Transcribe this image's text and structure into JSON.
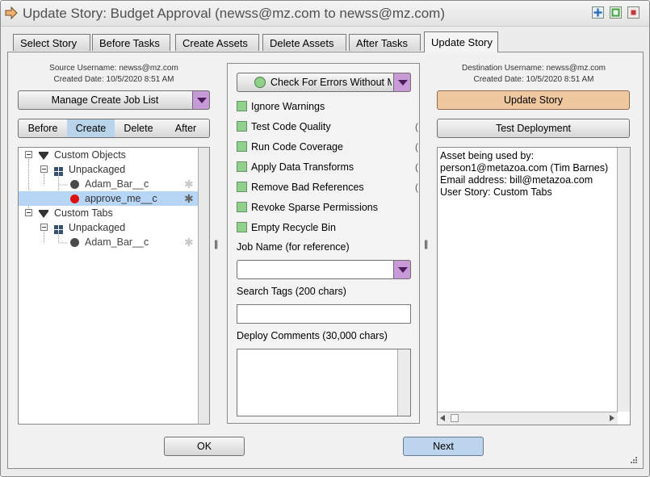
{
  "window": {
    "title": "Update Story: Budget Approval (newss@mz.com to newss@mz.com)",
    "buttons": [
      {
        "name": "maximize-button",
        "icon": "plus-icon",
        "color": "#2f6fc0"
      },
      {
        "name": "restore-button",
        "icon": "square-icon",
        "color": "#3fa33f"
      },
      {
        "name": "close-button",
        "icon": "stop-icon",
        "color": "#c23a3a"
      }
    ]
  },
  "tabs": [
    {
      "label": "Select Story"
    },
    {
      "label": "Before Tasks"
    },
    {
      "label": "Create Assets"
    },
    {
      "label": "Delete Assets"
    },
    {
      "label": "After Tasks"
    },
    {
      "label": "Update Story",
      "active": true
    }
  ],
  "source": {
    "username_line": "Source Username: newss@mz.com",
    "date_line": "Created Date: 10/5/2020 8:51 AM"
  },
  "destination": {
    "username_line": "Destination Username: newss@mz.com",
    "date_line": "Created Date: 10/5/2020 8:51 AM"
  },
  "left": {
    "manage_dropdown": "Manage Create Job List",
    "segments": [
      "Before",
      "Create",
      "Delete",
      "After"
    ],
    "selected_segment": "Create",
    "tree": [
      {
        "label": "Custom Objects",
        "kind": "folder",
        "level": 0
      },
      {
        "label": "Unpackaged",
        "kind": "package",
        "level": 1
      },
      {
        "label": "Adam_Bar__c",
        "kind": "item",
        "status": "gray",
        "level": 2
      },
      {
        "label": "approve_me__c",
        "kind": "item",
        "status": "red",
        "level": 2,
        "selected": true
      },
      {
        "label": "Custom Tabs",
        "kind": "folder",
        "level": 0
      },
      {
        "label": "Unpackaged",
        "kind": "package",
        "level": 1
      },
      {
        "label": "Adam_Bar__c",
        "kind": "item",
        "status": "gray",
        "level": 2
      }
    ]
  },
  "middle": {
    "check_dropdown": "Check For Errors Without M",
    "checkboxes": [
      {
        "label": "Ignore Warnings"
      },
      {
        "label": "Test Code Quality"
      },
      {
        "label": "Run Code Coverage"
      },
      {
        "label": "Apply Data Transforms"
      },
      {
        "label": "Remove Bad References"
      },
      {
        "label": "Revoke Sparse Permissions"
      },
      {
        "label": "Empty Recycle Bin"
      }
    ],
    "job_name_label": "Job Name (for reference)",
    "job_name_value": "",
    "search_tags_label": "Search Tags (200 chars)",
    "search_tags_value": "",
    "deploy_comments_label": "Deploy Comments (30,000 chars)",
    "deploy_comments_value": ""
  },
  "right": {
    "update_button": "Update Story",
    "test_button": "Test Deployment",
    "text_lines": [
      "Asset being used by:",
      "person1@metazoa.com (Tim Barnes)",
      "Email address: bill@metazoa.com",
      "User Story: Custom Tabs"
    ]
  },
  "footer": {
    "ok_button": "OK",
    "next_button": "Next"
  },
  "colors": {
    "accent_purple": "#c89ad6",
    "update_button": "#f0c8a0",
    "next_button": "#bcd4ec",
    "checkbox_green": "#8fd18a",
    "selected_row": "#b7d5f4"
  }
}
